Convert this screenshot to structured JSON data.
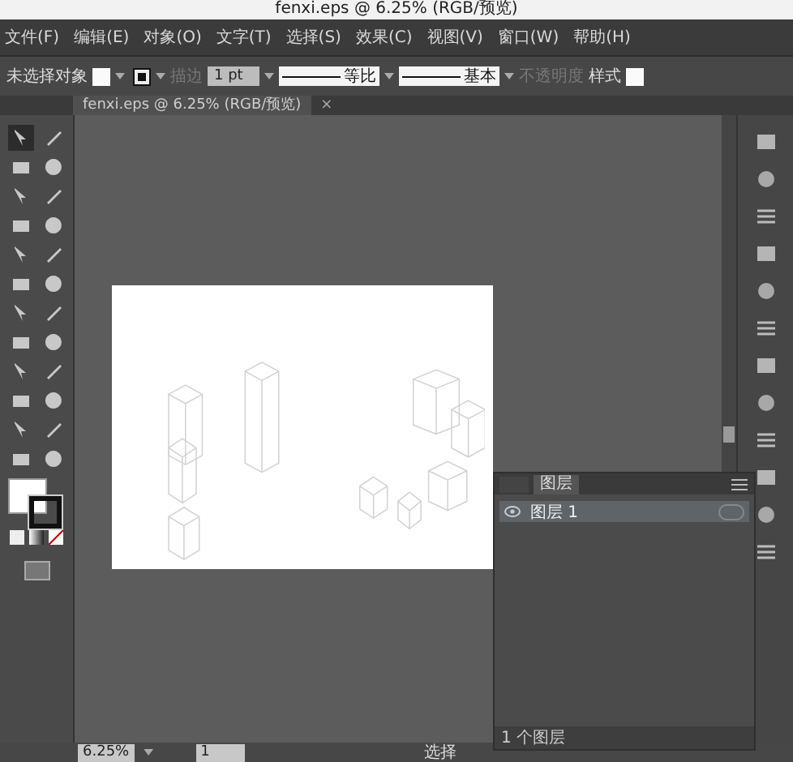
{
  "window": {
    "title": "fenxi.eps @ 6.25% (RGB/预览)"
  },
  "menu": [
    "文件(F)",
    "编辑(E)",
    "对象(O)",
    "文字(T)",
    "选择(S)",
    "效果(C)",
    "视图(V)",
    "窗口(W)",
    "帮助(H)"
  ],
  "control_bar": {
    "selection": "未选择对象",
    "stroke_label": "描边",
    "stroke_weight": "1 pt",
    "profile": "等比",
    "brush": "基本",
    "opacity_label": "不透明度",
    "style_label": "样式"
  },
  "document_tab": {
    "title": "fenxi.eps @ 6.25% (RGB/预览)",
    "close": "×"
  },
  "tools": [
    {
      "selected": true
    },
    {
      "selected": false
    },
    {
      "selected": false
    },
    {
      "selected": false
    },
    {
      "selected": false
    },
    {
      "selected": false
    },
    {
      "selected": false
    },
    {
      "selected": false
    },
    {
      "selected": false
    },
    {
      "selected": false
    },
    {
      "selected": false
    },
    {
      "selected": false
    },
    {
      "selected": false
    },
    {
      "selected": false
    },
    {
      "selected": false
    },
    {
      "selected": false
    },
    {
      "selected": false
    },
    {
      "selected": false
    },
    {
      "selected": false
    },
    {
      "selected": false
    },
    {
      "selected": false
    },
    {
      "selected": false
    },
    {
      "selected": false
    },
    {
      "selected": false
    }
  ],
  "layers_panel": {
    "tab": "图层",
    "layers": [
      {
        "name": "图层 1",
        "visible": true
      }
    ],
    "footer": "1 个图层"
  },
  "status_bar": {
    "zoom": "6.25%",
    "artboard": "1",
    "tool": "选择"
  }
}
